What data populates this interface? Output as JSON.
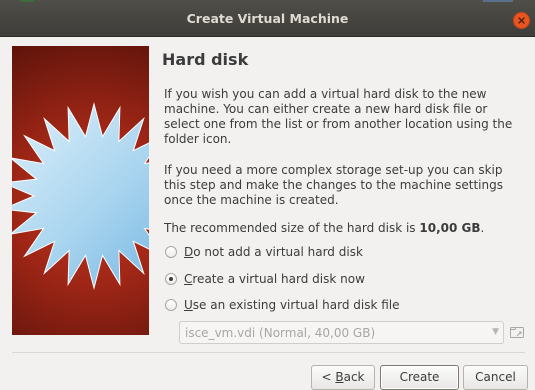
{
  "window": {
    "title": "Create Virtual Machine",
    "close_icon": "close-icon"
  },
  "page": {
    "heading": "Hard disk",
    "paragraph1": "If you wish you can add a virtual hard disk to the new machine. You can either create a new hard disk file or select one from the list or from another location using the folder icon.",
    "paragraph2": "If you need a more complex storage set-up you can skip this step and make the changes to the machine settings once the machine is created.",
    "recommended_prefix": "The recommended size of the hard disk is ",
    "recommended_size": "10,00 GB",
    "recommended_suffix": "."
  },
  "options": [
    {
      "mnemonic": "D",
      "rest": "o not add a virtual hard disk",
      "selected": false
    },
    {
      "mnemonic": "C",
      "rest": "reate a virtual hard disk now",
      "selected": true
    },
    {
      "mnemonic": "U",
      "rest": "se an existing virtual hard disk file",
      "selected": false
    }
  ],
  "disk_select": {
    "value": "isce_vm.vdi (Normal, 40,00 GB)",
    "enabled": false
  },
  "buttons": {
    "back_prefix": "< ",
    "back_mnemonic": "B",
    "back_rest": "ack",
    "create": "Create",
    "cancel": "Cancel"
  },
  "colors": {
    "titlebar": "#3e3d39",
    "close": "#e95420",
    "side_panel": "#9e2616",
    "window_bg": "#f2f1f0"
  }
}
